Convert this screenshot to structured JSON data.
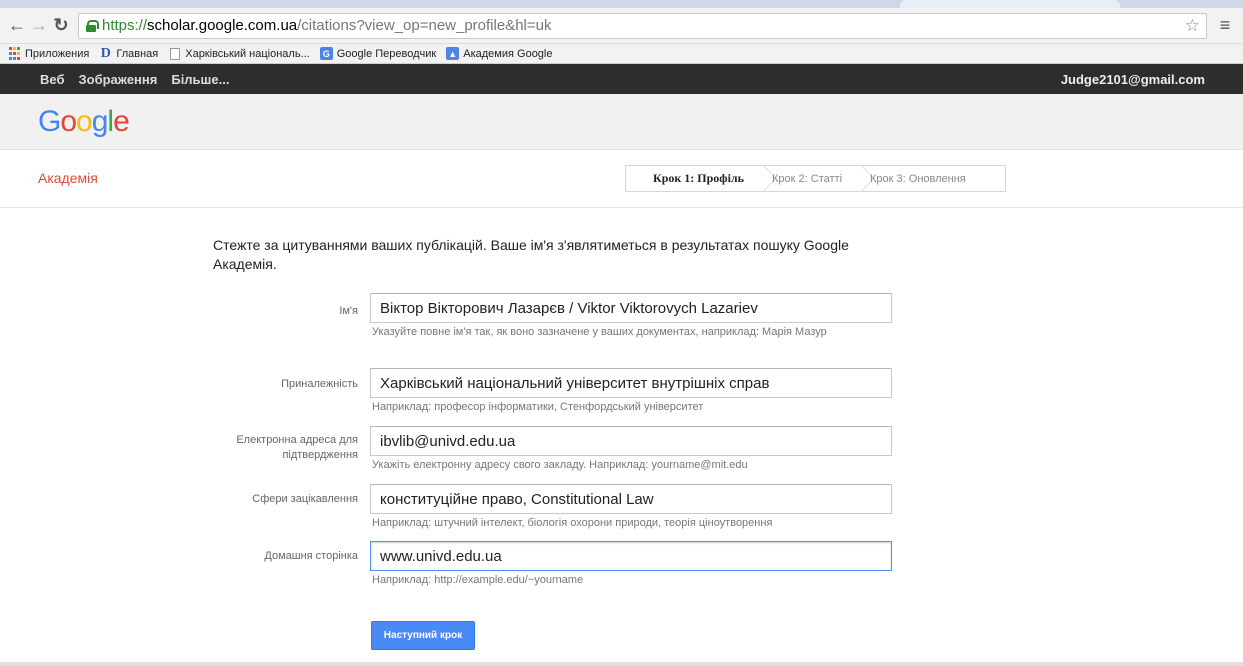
{
  "browser": {
    "url_scheme": "https://",
    "url_host": "scholar.google.com.ua",
    "url_path": "/citations?view_op=new_profile&hl=uk",
    "bookmarks": [
      {
        "label": "Приложения",
        "icon": "apps-icon"
      },
      {
        "label": "Главная",
        "icon": "d-icon"
      },
      {
        "label": "Харківський національ...",
        "icon": "page-icon"
      },
      {
        "label": "Google Переводчик",
        "icon": "translate-icon"
      },
      {
        "label": "Академия Google",
        "icon": "scholar-icon"
      }
    ]
  },
  "gbar": {
    "links": [
      "Веб",
      "Зображення",
      "Більше..."
    ],
    "account": "Judge2101@gmail.com"
  },
  "logo": {
    "letters": [
      "G",
      "o",
      "o",
      "g",
      "l",
      "e"
    ],
    "colors": [
      "#4285f4",
      "#ea4335",
      "#fbbc05",
      "#4285f4",
      "#34a853",
      "#ea4335"
    ]
  },
  "scholar": {
    "title": "Академія",
    "steps": [
      "Крок 1: Профіль",
      "Крок 2: Статті",
      "Крок 3: Оновлення"
    ]
  },
  "form": {
    "intro": "Стежте за цитуваннями ваших публікацій. Ваше ім'я з'являтиметься в результатах пошуку Google Академія.",
    "fields": [
      {
        "label": "Ім'я",
        "value": "Віктор Вікторович Лазарєв / Viktor Viktorovych Lazariev",
        "hint": "Указуйте повне ім'я так, як воно зазначене у ваших документах, наприклад: Марія Мазур"
      },
      {
        "label": "Приналежність",
        "value": "Харківський національний університет внутрішніх справ",
        "hint": "Наприклад: професор інформатики, Стенфордський університет"
      },
      {
        "label": "Електронна адреса для підтвердження",
        "value": "ibvlib@univd.edu.ua",
        "hint": "Укажіть електронну адресу свого закладу. Наприклад: yourname@mit.edu"
      },
      {
        "label": "Сфери зацікавлення",
        "value": "конституційне право, Constitutional Law",
        "hint": "Наприклад: штучний інтелект, біологія охорони природи, теорія ціноутворення"
      },
      {
        "label": "Домашня сторінка",
        "value": "www.univd.edu.ua",
        "hint": "Наприклад: http://example.edu/~yourname"
      }
    ],
    "next_button": "Наступний крок"
  },
  "colors": {
    "accent_red": "#dd4b39",
    "button_blue": "#4a8af4",
    "focus_blue": "#4d90fe",
    "gbar_bg": "#2d2d2d"
  }
}
